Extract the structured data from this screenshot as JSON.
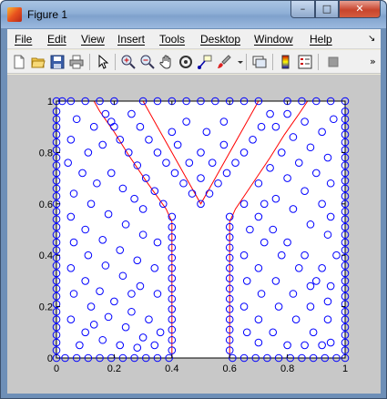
{
  "window": {
    "title": "Figure 1",
    "ghost_title": "...",
    "controls": {
      "minimize": "–",
      "maximize": "□",
      "close": "✕"
    }
  },
  "menubar": {
    "items": [
      "File",
      "Edit",
      "View",
      "Insert",
      "Tools",
      "Desktop",
      "Window",
      "Help"
    ],
    "overflow_arrow": "↘"
  },
  "toolbar": {
    "icons": [
      "new-figure-icon",
      "open-file-icon",
      "save-icon",
      "print-icon",
      "edit-plot-arrow-icon",
      "zoom-in-icon",
      "zoom-out-icon",
      "pan-hand-icon",
      "rotate-3d-icon",
      "data-cursor-icon",
      "brush-icon",
      "link-plot-icon",
      "colorbar-icon",
      "legend-icon",
      "hide-plot-tools-icon"
    ],
    "overflow": "»"
  },
  "chart_data": {
    "type": "scatter",
    "xlim": [
      0,
      1
    ],
    "ylim": [
      0,
      1
    ],
    "xticks": [
      "0",
      "0.2",
      "0.4",
      "0.6",
      "0.8",
      "1"
    ],
    "yticks": [
      "0",
      "0.2",
      "0.4",
      "0.6",
      "0.8",
      "1"
    ],
    "grid": false,
    "series": [
      {
        "marker": "circle-open",
        "color": "#0000ff",
        "points": [
          [
            0,
            0
          ],
          [
            0,
            0.03
          ],
          [
            0,
            0.06
          ],
          [
            0,
            0.09
          ],
          [
            0,
            0.12
          ],
          [
            0,
            0.15
          ],
          [
            0,
            0.18
          ],
          [
            0,
            0.21
          ],
          [
            0,
            0.24
          ],
          [
            0,
            0.27
          ],
          [
            0,
            0.3
          ],
          [
            0,
            0.33
          ],
          [
            0,
            0.36
          ],
          [
            0,
            0.39
          ],
          [
            0,
            0.42
          ],
          [
            0,
            0.45
          ],
          [
            0,
            0.48
          ],
          [
            0,
            0.51
          ],
          [
            0,
            0.54
          ],
          [
            0,
            0.57
          ],
          [
            0,
            0.6
          ],
          [
            0,
            0.63
          ],
          [
            0,
            0.66
          ],
          [
            0,
            0.69
          ],
          [
            0,
            0.72
          ],
          [
            0,
            0.75
          ],
          [
            0,
            0.78
          ],
          [
            0,
            0.81
          ],
          [
            0,
            0.84
          ],
          [
            0,
            0.87
          ],
          [
            0,
            0.9
          ],
          [
            0,
            0.93
          ],
          [
            0,
            0.96
          ],
          [
            0,
            1
          ],
          [
            0.03,
            0
          ],
          [
            0.07,
            0
          ],
          [
            0.11,
            0
          ],
          [
            0.15,
            0
          ],
          [
            0.19,
            0
          ],
          [
            0.23,
            0
          ],
          [
            0.27,
            0
          ],
          [
            0.31,
            0
          ],
          [
            0.35,
            0
          ],
          [
            0.39,
            0
          ],
          [
            0.61,
            0
          ],
          [
            0.65,
            0
          ],
          [
            0.69,
            0
          ],
          [
            0.73,
            0
          ],
          [
            0.77,
            0
          ],
          [
            0.81,
            0
          ],
          [
            0.85,
            0
          ],
          [
            0.89,
            0
          ],
          [
            0.93,
            0
          ],
          [
            0.97,
            0
          ],
          [
            1,
            0
          ],
          [
            1,
            0.03
          ],
          [
            1,
            0.06
          ],
          [
            1,
            0.09
          ],
          [
            1,
            0.12
          ],
          [
            1,
            0.15
          ],
          [
            1,
            0.18
          ],
          [
            1,
            0.21
          ],
          [
            1,
            0.24
          ],
          [
            1,
            0.27
          ],
          [
            1,
            0.3
          ],
          [
            1,
            0.33
          ],
          [
            1,
            0.36
          ],
          [
            1,
            0.39
          ],
          [
            1,
            0.42
          ],
          [
            1,
            0.45
          ],
          [
            1,
            0.48
          ],
          [
            1,
            0.51
          ],
          [
            1,
            0.54
          ],
          [
            1,
            0.57
          ],
          [
            1,
            0.6
          ],
          [
            1,
            0.63
          ],
          [
            1,
            0.66
          ],
          [
            1,
            0.69
          ],
          [
            1,
            0.72
          ],
          [
            1,
            0.75
          ],
          [
            1,
            0.78
          ],
          [
            1,
            0.81
          ],
          [
            1,
            0.84
          ],
          [
            1,
            0.87
          ],
          [
            1,
            0.9
          ],
          [
            1,
            0.93
          ],
          [
            1,
            0.96
          ],
          [
            1,
            1
          ],
          [
            0.02,
            1
          ],
          [
            0.05,
            1
          ],
          [
            0.1,
            1
          ],
          [
            0.15,
            1
          ],
          [
            0.2,
            1
          ],
          [
            0.3,
            1
          ],
          [
            0.35,
            1
          ],
          [
            0.4,
            1
          ],
          [
            0.45,
            1
          ],
          [
            0.5,
            1
          ],
          [
            0.55,
            1
          ],
          [
            0.6,
            1
          ],
          [
            0.65,
            1
          ],
          [
            0.7,
            1
          ],
          [
            0.8,
            1
          ],
          [
            0.85,
            1
          ],
          [
            0.9,
            1
          ],
          [
            0.95,
            1
          ],
          [
            0.4,
            0.03
          ],
          [
            0.4,
            0.07
          ],
          [
            0.4,
            0.11
          ],
          [
            0.4,
            0.15
          ],
          [
            0.4,
            0.19
          ],
          [
            0.4,
            0.23
          ],
          [
            0.4,
            0.27
          ],
          [
            0.4,
            0.31
          ],
          [
            0.4,
            0.35
          ],
          [
            0.4,
            0.39
          ],
          [
            0.4,
            0.43
          ],
          [
            0.4,
            0.47
          ],
          [
            0.4,
            0.51
          ],
          [
            0.4,
            0.55
          ],
          [
            0.6,
            0.03
          ],
          [
            0.6,
            0.07
          ],
          [
            0.6,
            0.11
          ],
          [
            0.6,
            0.15
          ],
          [
            0.6,
            0.19
          ],
          [
            0.6,
            0.23
          ],
          [
            0.6,
            0.27
          ],
          [
            0.6,
            0.31
          ],
          [
            0.6,
            0.35
          ],
          [
            0.6,
            0.39
          ],
          [
            0.6,
            0.43
          ],
          [
            0.6,
            0.47
          ],
          [
            0.6,
            0.51
          ],
          [
            0.6,
            0.55
          ],
          [
            0.37,
            0.6
          ],
          [
            0.34,
            0.65
          ],
          [
            0.31,
            0.7
          ],
          [
            0.28,
            0.75
          ],
          [
            0.25,
            0.8
          ],
          [
            0.22,
            0.85
          ],
          [
            0.2,
            0.9
          ],
          [
            0.17,
            0.95
          ],
          [
            0.5,
            0.6
          ],
          [
            0.53,
            0.64
          ],
          [
            0.56,
            0.68
          ],
          [
            0.59,
            0.72
          ],
          [
            0.62,
            0.76
          ],
          [
            0.65,
            0.8
          ],
          [
            0.68,
            0.85
          ],
          [
            0.71,
            0.9
          ],
          [
            0.74,
            0.95
          ],
          [
            0.47,
            0.64
          ],
          [
            0.44,
            0.68
          ],
          [
            0.41,
            0.72
          ],
          [
            0.38,
            0.76
          ],
          [
            0.35,
            0.8
          ],
          [
            0.32,
            0.85
          ],
          [
            0.29,
            0.9
          ],
          [
            0.26,
            0.95
          ],
          [
            0.07,
            0.93
          ],
          [
            0.13,
            0.9
          ],
          [
            0.19,
            0.92
          ],
          [
            0.05,
            0.85
          ],
          [
            0.11,
            0.8
          ],
          [
            0.16,
            0.83
          ],
          [
            0.04,
            0.76
          ],
          [
            0.09,
            0.72
          ],
          [
            0.14,
            0.68
          ],
          [
            0.19,
            0.72
          ],
          [
            0.23,
            0.66
          ],
          [
            0.06,
            0.64
          ],
          [
            0.12,
            0.6
          ],
          [
            0.18,
            0.56
          ],
          [
            0.24,
            0.52
          ],
          [
            0.3,
            0.48
          ],
          [
            0.35,
            0.45
          ],
          [
            0.05,
            0.55
          ],
          [
            0.1,
            0.5
          ],
          [
            0.16,
            0.46
          ],
          [
            0.22,
            0.42
          ],
          [
            0.28,
            0.38
          ],
          [
            0.34,
            0.35
          ],
          [
            0.06,
            0.45
          ],
          [
            0.11,
            0.4
          ],
          [
            0.17,
            0.36
          ],
          [
            0.23,
            0.32
          ],
          [
            0.29,
            0.28
          ],
          [
            0.35,
            0.25
          ],
          [
            0.05,
            0.35
          ],
          [
            0.1,
            0.3
          ],
          [
            0.15,
            0.26
          ],
          [
            0.2,
            0.22
          ],
          [
            0.26,
            0.18
          ],
          [
            0.32,
            0.15
          ],
          [
            0.36,
            0.1
          ],
          [
            0.06,
            0.25
          ],
          [
            0.12,
            0.2
          ],
          [
            0.18,
            0.16
          ],
          [
            0.24,
            0.12
          ],
          [
            0.3,
            0.08
          ],
          [
            0.05,
            0.15
          ],
          [
            0.1,
            0.1
          ],
          [
            0.16,
            0.07
          ],
          [
            0.22,
            0.05
          ],
          [
            0.28,
            0.04
          ],
          [
            0.34,
            0.05
          ],
          [
            0.08,
            0.05
          ],
          [
            0.13,
            0.13
          ],
          [
            0.26,
            0.25
          ],
          [
            0.3,
            0.58
          ],
          [
            0.27,
            0.62
          ],
          [
            0.4,
            0.88
          ],
          [
            0.45,
            0.92
          ],
          [
            0.52,
            0.88
          ],
          [
            0.58,
            0.92
          ],
          [
            0.5,
            0.8
          ],
          [
            0.46,
            0.76
          ],
          [
            0.54,
            0.76
          ],
          [
            0.5,
            0.7
          ],
          [
            0.42,
            0.83
          ],
          [
            0.58,
            0.83
          ],
          [
            0.65,
            0.6
          ],
          [
            0.7,
            0.55
          ],
          [
            0.75,
            0.5
          ],
          [
            0.8,
            0.45
          ],
          [
            0.86,
            0.4
          ],
          [
            0.92,
            0.35
          ],
          [
            0.95,
            0.28
          ],
          [
            0.67,
            0.5
          ],
          [
            0.72,
            0.45
          ],
          [
            0.78,
            0.4
          ],
          [
            0.84,
            0.35
          ],
          [
            0.9,
            0.3
          ],
          [
            0.65,
            0.4
          ],
          [
            0.7,
            0.35
          ],
          [
            0.76,
            0.3
          ],
          [
            0.82,
            0.25
          ],
          [
            0.88,
            0.2
          ],
          [
            0.94,
            0.15
          ],
          [
            0.66,
            0.3
          ],
          [
            0.71,
            0.25
          ],
          [
            0.77,
            0.2
          ],
          [
            0.83,
            0.15
          ],
          [
            0.89,
            0.1
          ],
          [
            0.95,
            0.06
          ],
          [
            0.65,
            0.2
          ],
          [
            0.7,
            0.15
          ],
          [
            0.75,
            0.1
          ],
          [
            0.8,
            0.05
          ],
          [
            0.86,
            0.05
          ],
          [
            0.66,
            0.1
          ],
          [
            0.7,
            0.06
          ],
          [
            0.92,
            0.05
          ],
          [
            0.94,
            0.22
          ],
          [
            0.88,
            0.28
          ],
          [
            0.7,
            0.68
          ],
          [
            0.76,
            0.62
          ],
          [
            0.82,
            0.58
          ],
          [
            0.88,
            0.52
          ],
          [
            0.94,
            0.48
          ],
          [
            0.74,
            0.74
          ],
          [
            0.8,
            0.7
          ],
          [
            0.86,
            0.65
          ],
          [
            0.92,
            0.6
          ],
          [
            0.95,
            0.55
          ],
          [
            0.78,
            0.8
          ],
          [
            0.84,
            0.76
          ],
          [
            0.9,
            0.72
          ],
          [
            0.95,
            0.68
          ],
          [
            0.82,
            0.86
          ],
          [
            0.88,
            0.82
          ],
          [
            0.94,
            0.78
          ],
          [
            0.86,
            0.92
          ],
          [
            0.92,
            0.88
          ],
          [
            0.96,
            0.93
          ],
          [
            0.8,
            0.95
          ],
          [
            0.76,
            0.9
          ],
          [
            0.72,
            0.6
          ],
          [
            0.97,
            0.4
          ]
        ]
      },
      {
        "type": "boundary-line",
        "color": "#ff0000",
        "polylines": [
          [
            [
              0.4,
              0
            ],
            [
              0.4,
              0.53
            ],
            [
              0.38,
              0.58
            ],
            [
              0.31,
              0.69
            ],
            [
              0.25,
              0.79
            ],
            [
              0.2,
              0.88
            ],
            [
              0.15,
              0.96
            ],
            [
              0.13,
              1
            ]
          ],
          [
            [
              0.6,
              0
            ],
            [
              0.6,
              0.53
            ],
            [
              0.62,
              0.58
            ],
            [
              0.68,
              0.68
            ],
            [
              0.74,
              0.78
            ],
            [
              0.79,
              0.87
            ],
            [
              0.84,
              0.95
            ],
            [
              0.87,
              1
            ]
          ],
          [
            [
              0.3,
              1
            ],
            [
              0.35,
              0.9
            ],
            [
              0.4,
              0.8
            ],
            [
              0.45,
              0.7
            ],
            [
              0.5,
              0.6
            ],
            [
              0.55,
              0.7
            ],
            [
              0.6,
              0.8
            ],
            [
              0.65,
              0.9
            ],
            [
              0.7,
              1
            ]
          ]
        ]
      },
      {
        "type": "boundary-line",
        "color": "#000000",
        "polylines": [
          [
            [
              0.4,
              0
            ],
            [
              0.6,
              0
            ]
          ],
          [
            [
              0.13,
              1
            ],
            [
              0.3,
              1
            ]
          ],
          [
            [
              0.7,
              1
            ],
            [
              0.87,
              1
            ]
          ]
        ]
      }
    ]
  }
}
